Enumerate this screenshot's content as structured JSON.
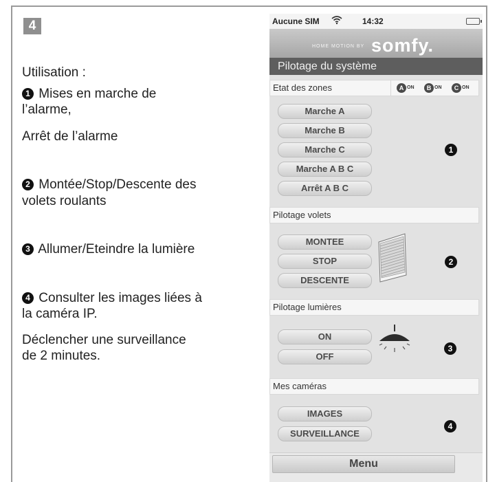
{
  "step_badge": "4",
  "left_column": {
    "usage_heading": "Utilisation :",
    "item1_num": "1",
    "item1_line1": "Mises en marche de",
    "item1_line2": "l’alarme,",
    "item1_line3": "Arrêt de l’alarme",
    "item2_num": "2",
    "item2_line1": "Montée/Stop/Descente des",
    "item2_line2": "volets roulants",
    "item3_num": "3",
    "item3_line1": "Allumer/Eteindre la lumière",
    "item4_num": "4",
    "item4_line1": "Consulter les images liées à",
    "item4_line2": "la caméra IP.",
    "item4_line3": "Déclencher une surveillance",
    "item4_line4": "de 2 minutes."
  },
  "phone": {
    "statusbar": {
      "carrier": "Aucune SIM",
      "wifi_icon": "wifi-icon",
      "time": "14:32",
      "battery_icon": "battery-icon"
    },
    "brand": {
      "tagline": "HOME MOTION BY",
      "logo": "somfy."
    },
    "title": "Pilotage du système",
    "zones": {
      "label": "Etat des zones",
      "items": [
        {
          "letter": "A",
          "state": "ON"
        },
        {
          "letter": "B",
          "state": "ON"
        },
        {
          "letter": "C",
          "state": "ON"
        }
      ]
    },
    "alarm_buttons": [
      "Marche A",
      "Marche B",
      "Marche C",
      "Marche A B C",
      "Arrêt A B C"
    ],
    "shutters": {
      "label": "Pilotage volets",
      "buttons": [
        "MONTEE",
        "STOP",
        "DESCENTE"
      ]
    },
    "lights": {
      "label": "Pilotage lumières",
      "buttons": [
        "ON",
        "OFF"
      ]
    },
    "cameras": {
      "label": "Mes caméras",
      "buttons": [
        "IMAGES",
        "SURVEILLANCE"
      ]
    },
    "callouts": [
      "1",
      "2",
      "3",
      "4"
    ],
    "menu_label": "Menu"
  },
  "colors": {
    "frame": "#9a9a9a",
    "title_bar": "#5e5e5e",
    "panel_bg": "#e2e2e2"
  }
}
